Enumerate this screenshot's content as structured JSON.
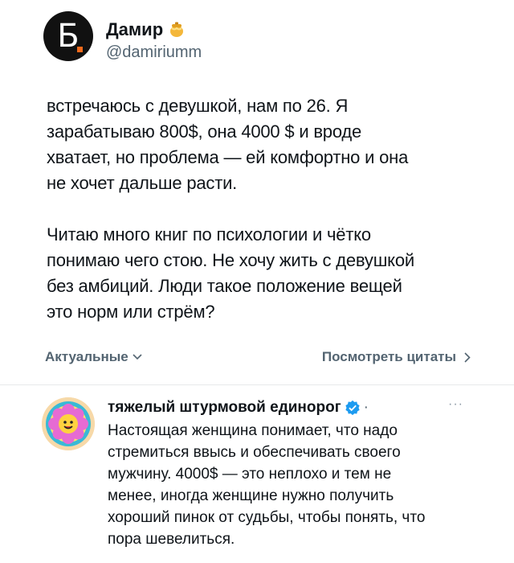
{
  "author": {
    "display_name": "Дамир",
    "handle": "@damiriumm",
    "avatar_letter": "Б",
    "avatar_dot_color": "#f26a1b",
    "badge_icon": "honey-pot-icon"
  },
  "tweet": {
    "paragraph1": "встречаюсь с девушкой, нам по 26. Я\nзарабатываю 800$, она 4000 $ и вроде\nхватает, но проблема — ей комфортно и она\nне хочет дальше расти.",
    "paragraph2": "Читаю много книг по психологии и чётко\nпонимаю чего стою. Не хочу жить с девушкой\nбез амбиций. Люди такое положение вещей\nэто норм или стрём?"
  },
  "toolbar": {
    "sort_label": "Актуальные",
    "sort_icon": "chevron-down-icon",
    "quotes_label": "Посмотреть цитаты",
    "quotes_icon": "chevron-right-icon"
  },
  "reply": {
    "display_name": "тяжелый штурмовой единорог",
    "separator": "·",
    "more": "···",
    "verified_icon": "verified-badge-icon",
    "avatar_icon": "flower-smiley-icon",
    "text": "Настоящая женщина понимает, что надо\nстремиться ввысь и обеспечивать своего\nмужчину. 4000$ — это неплохо и тем не\nменее, иногда женщине нужно получить\nхороший пинок от судьбы, чтобы понять, что\nпора шевелиться."
  },
  "colors": {
    "text": "#0f1419",
    "secondary": "#536471",
    "verified": "#1d9bf0",
    "divider": "#e7e9ea"
  }
}
